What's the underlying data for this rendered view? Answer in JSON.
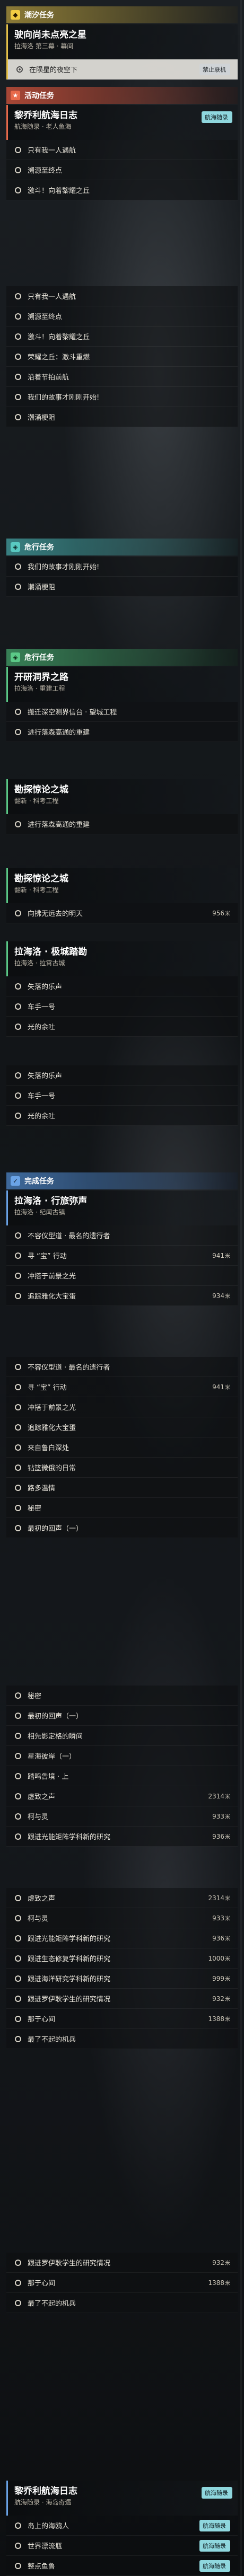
{
  "h1": "潮汐任务",
  "h2": "活动任务",
  "h3": "危行任务",
  "h4": "危行任务",
  "h5": "完成任务",
  "q1": {
    "title": "驶向尚未点亮之星",
    "sub": "拉海洛 第三幕 · 幕间"
  },
  "o1": "在陨星的夜空下",
  "tag1": "禁止联机",
  "q2": {
    "title": "黎乔利航海日志",
    "sub": "航海随录 · 老人鱼海"
  },
  "tag2": "航海随录",
  "o2": "只有我一人遇航",
  "o3": "溯源至终点",
  "o4": "激斗！向着黎耀之丘",
  "o5": "只有我一人遇航",
  "o6": "溯源至终点",
  "o7": "激斗！向着黎耀之丘",
  "o8": "荣耀之丘：激斗重燃",
  "o9": "沿着节拍前航",
  "o10": "我们的故事才刚刚开始!",
  "o11": "潮涌梗阻",
  "o12": "我们的故事才刚刚开始!",
  "o13": "潮涌梗阻",
  "q3": {
    "title": "开研洞界之路",
    "sub": "拉海洛 · 重建工程"
  },
  "o14": "搬迁深空测界信台 · 望城工程",
  "o15": "进行落森高通的重建",
  "q4": {
    "title": "勘探惊论之城",
    "sub": "翻新 · 科考工程"
  },
  "o16": "进行落森高通的重建",
  "q5": {
    "title": "勘探惊论之城",
    "sub": "翻新 · 科考工程"
  },
  "o17": "向拂无远去的明天",
  "v17": "956",
  "q6": {
    "title": "拉海洛 · 极城踏勘",
    "sub": "拉海洛 · 拉霄古城"
  },
  "o18": "失落的乐声",
  "o19": "车手一号",
  "o20": "光的余吐",
  "o21": "失落的乐声",
  "o22": "车手一号",
  "o23": "光的余吐",
  "q7": {
    "title": "拉海洛 · 行旅弥声",
    "sub": "拉海洛 · 纪闻古镇"
  },
  "o24": "不容仪型道 · 最名的遗行者",
  "o25": "寻 “宝” 行动",
  "v25": "941",
  "o26": "冲搭于前景之光",
  "o27": "追踪雅化大宝蛋",
  "v27": "934",
  "o28": "不容仪型道 · 最名的遗行者",
  "o29": "寻 “宝” 行动",
  "v29": "941",
  "o30": "冲搭于前景之光",
  "o31": "追踪雅化大宝蛋",
  "o32": "来自鲁白深处",
  "o33": "钻篮微俄的日常",
  "o34": "路多温情",
  "o35": "秘密",
  "o36": "最初的回声（一）",
  "o37": "秘密",
  "o38": "最初的回声（一）",
  "o39": "相先影定格的瞬间",
  "o40": "星海彼岸（一）",
  "o41": "踏鸣告境 · 上",
  "o42": "虚致之声",
  "v42": "2314",
  "o43": "柯与灵",
  "v43": "933",
  "o44": "跟进光能矩阵学科新的研究",
  "v44": "936",
  "o45": "虚致之声",
  "v45": "2314",
  "o46": "柯与灵",
  "v46": "933",
  "o47": "跟进光能矩阵学科新的研究",
  "v47": "936",
  "o48": "跟进生态修复学科新的研究",
  "v48": "1000",
  "o49": "跟进海洋研究学科新的研究",
  "v49": "999",
  "o50": "跟进罗伊耿学生的研究情况",
  "v50": "932",
  "o51": "那于心间",
  "v51": "1388",
  "o52": "最了不起的机兵",
  "o53": "跟进罗伊耿学生的研究情况",
  "v53": "932",
  "o54": "那于心间",
  "v54": "1388",
  "o55": "最了不起的机兵",
  "q8": {
    "title": "黎乔利航海日志",
    "sub": "航海随录 · 海岛奇遇"
  },
  "tag8": "航海随录",
  "o56": "岛上的海鸥人",
  "tag56": "航海随录",
  "o57": "世界漂流瓶",
  "tag57": "航海随录",
  "o58": "整点鱼鲁",
  "tag58": "航海随录",
  "unit": "米",
  "colors": {
    "gold": "#e6c24a",
    "red": "#e86a4b",
    "cyan": "#59c9c1",
    "green": "#5bc987",
    "blue": "#6aa3e6"
  }
}
